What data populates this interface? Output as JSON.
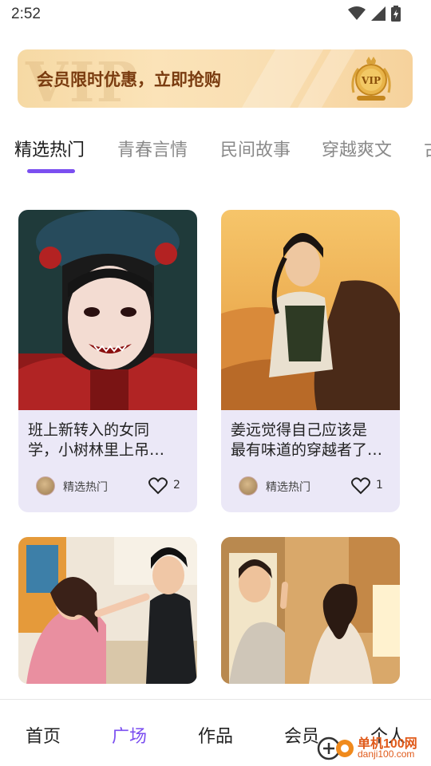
{
  "status_bar": {
    "time": "2:52"
  },
  "vip_banner": {
    "text": "会员限时优惠，立即抢购",
    "watermark": "VIP",
    "medal_label": "VIP"
  },
  "tabs": [
    {
      "label": "精选热门",
      "active": true
    },
    {
      "label": "青春言情"
    },
    {
      "label": "民间故事"
    },
    {
      "label": "穿越爽文"
    },
    {
      "label": "古"
    }
  ],
  "cards": [
    {
      "title_line1": "班上新转入的女同",
      "title_line2": "学，小树林里上吊…",
      "tag": "精选热门",
      "likes": "2"
    },
    {
      "title_line1": "姜远觉得自己应该是",
      "title_line2": "最有味道的穿越者了…",
      "tag": "精选热门",
      "likes": "1"
    },
    {
      "title_line1": "",
      "title_line2": "",
      "tag": "",
      "likes": ""
    },
    {
      "title_line1": "",
      "title_line2": "",
      "tag": "",
      "likes": ""
    }
  ],
  "bottom_nav": [
    {
      "label": "首页"
    },
    {
      "label": "广场",
      "active": true
    },
    {
      "label": "作品"
    },
    {
      "label": "会员"
    },
    {
      "label": "个人"
    }
  ],
  "site_watermark": {
    "name": "单机100网",
    "url": "danji100.com"
  },
  "colors": {
    "accent": "#7b4ff0",
    "card_bg": "#ebe8f7",
    "banner_text": "#7a3c10"
  }
}
